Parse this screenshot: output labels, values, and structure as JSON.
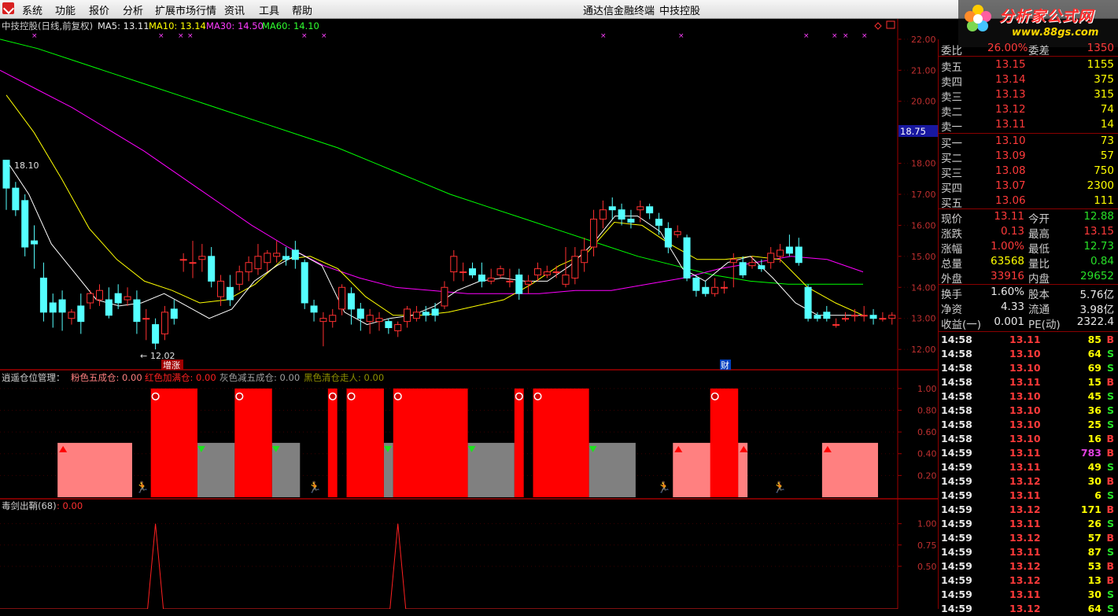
{
  "menubar": {
    "items": [
      "系统",
      "功能",
      "报价",
      "分析",
      "扩展市场行情",
      "资讯",
      "工具",
      "帮助"
    ],
    "center_title": "通达信金融终端",
    "center_stock": "中技控股"
  },
  "watermark": {
    "title": "分析家公式网",
    "url": "www.88gs.com"
  },
  "chart_header": {
    "name": "中技控股(日线,前复权)",
    "ma5": "MA5: 13.11",
    "ma10": "MA10: 13.14",
    "ma30": "MA30: 14.50",
    "ma60": "MA60: 14.10"
  },
  "panel2_header": {
    "title": "逍遥仓位管理：",
    "pink": "粉色五成仓: 0.00",
    "red": "红色加满仓: 0.00",
    "gray": "灰色减五成仓: 0.00",
    "black": "黑色清仓走人: 0.00"
  },
  "panel3_header": {
    "title": "毒剑出鞘(68)",
    "value": ": 0.00"
  },
  "annotations": {
    "high": "18.10",
    "low": "12.02",
    "tag1": "增涨",
    "tag2": "财",
    "price_marker": "18.75"
  },
  "axes": {
    "price": [
      "22.00",
      "21.00",
      "20.00",
      "18.00",
      "17.00",
      "16.00",
      "15.00",
      "14.00",
      "13.00",
      "12.00"
    ],
    "pos": [
      "1.00",
      "0.80",
      "0.60",
      "0.40",
      "0.20"
    ],
    "sig": [
      "1.00",
      "0.75",
      "0.50"
    ]
  },
  "colors": {
    "up": "#ff3030",
    "down": "#54ffff",
    "ma5": "#ffffff",
    "ma10": "#ffff00",
    "ma30": "#ff00ff",
    "ma60": "#00ff00"
  },
  "chart_data": [
    {
      "type": "candlestick",
      "title": "中技控股(日线,前复权)",
      "ylim": [
        11.8,
        22.2
      ],
      "candles": [
        [
          18.1,
          17.2,
          18.1,
          16.5
        ],
        [
          17.2,
          16.5,
          17.4,
          16.3
        ],
        [
          16.8,
          15.3,
          17.0,
          15.0
        ],
        [
          15.5,
          15.4,
          16.0,
          14.6
        ],
        [
          14.3,
          13.2,
          14.8,
          12.9
        ],
        [
          13.5,
          13.2,
          13.8,
          12.7
        ],
        [
          13.6,
          13.2,
          13.9,
          12.6
        ],
        [
          13.0,
          13.2,
          13.3,
          12.8
        ],
        [
          13.4,
          12.9,
          13.8,
          12.5
        ],
        [
          13.5,
          13.8,
          13.9,
          13.3
        ],
        [
          13.6,
          13.9,
          14.1,
          13.4
        ],
        [
          13.6,
          13.1,
          14.0,
          13.0
        ],
        [
          13.8,
          13.5,
          14.1,
          13.3
        ],
        [
          13.6,
          13.7,
          14.0,
          13.4
        ],
        [
          13.6,
          12.9,
          13.9,
          12.5
        ],
        [
          13.0,
          13.0,
          13.3,
          12.3
        ],
        [
          12.8,
          12.2,
          13.0,
          12.0
        ],
        [
          12.5,
          13.2,
          13.4,
          12.3
        ],
        [
          13.3,
          13.0,
          13.6,
          12.8
        ],
        [
          14.9,
          14.9,
          15.1,
          14.5
        ],
        [
          14.8,
          14.8,
          15.5,
          14.3
        ],
        [
          14.9,
          15.0,
          15.4,
          14.5
        ],
        [
          15.0,
          14.2,
          15.3,
          14.0
        ],
        [
          13.7,
          14.2,
          14.4,
          13.4
        ],
        [
          14.0,
          13.6,
          14.4,
          13.4
        ],
        [
          14.1,
          14.5,
          14.7,
          13.9
        ],
        [
          14.5,
          14.8,
          15.0,
          14.2
        ],
        [
          14.6,
          15.0,
          15.4,
          14.4
        ],
        [
          14.8,
          15.1,
          15.2,
          14.5
        ],
        [
          15.0,
          15.1,
          15.5,
          14.8
        ],
        [
          15.0,
          14.9,
          15.3,
          14.7
        ],
        [
          15.2,
          14.9,
          15.5,
          14.6
        ],
        [
          14.8,
          13.5,
          14.9,
          13.3
        ],
        [
          13.4,
          13.2,
          13.6,
          12.9
        ],
        [
          12.9,
          13.0,
          13.2,
          12.1
        ],
        [
          12.9,
          13.1,
          13.3,
          12.7
        ],
        [
          13.3,
          14.0,
          14.1,
          13.1
        ],
        [
          13.8,
          13.3,
          14.0,
          12.8
        ],
        [
          13.3,
          13.0,
          13.5,
          12.6
        ],
        [
          12.9,
          13.1,
          13.3,
          12.5
        ],
        [
          12.9,
          13.0,
          13.2,
          12.6
        ],
        [
          12.9,
          12.7,
          13.0,
          12.5
        ],
        [
          12.6,
          12.8,
          12.9,
          12.4
        ],
        [
          12.9,
          13.3,
          13.4,
          12.7
        ],
        [
          13.0,
          13.2,
          13.4,
          12.9
        ],
        [
          13.2,
          13.1,
          13.4,
          12.9
        ],
        [
          13.3,
          13.1,
          13.5,
          12.9
        ],
        [
          13.4,
          14.0,
          14.2,
          13.3
        ],
        [
          14.5,
          15.0,
          15.2,
          14.2
        ],
        [
          14.5,
          14.5,
          14.8,
          14.2
        ],
        [
          14.6,
          14.4,
          14.8,
          14.3
        ],
        [
          14.4,
          14.2,
          14.8,
          14.0
        ],
        [
          14.2,
          14.3,
          14.6,
          14.1
        ],
        [
          14.4,
          14.6,
          14.7,
          14.3
        ],
        [
          14.2,
          14.2,
          14.6,
          14.0
        ],
        [
          14.4,
          13.8,
          14.6,
          13.6
        ],
        [
          14.1,
          14.2,
          14.4,
          13.8
        ],
        [
          14.4,
          14.6,
          14.8,
          14.2
        ],
        [
          14.4,
          14.5,
          14.7,
          14.3
        ],
        [
          14.5,
          14.5,
          14.7,
          14.3
        ],
        [
          14.1,
          14.4,
          15.3,
          14.0
        ],
        [
          14.3,
          15.0,
          15.3,
          14.1
        ],
        [
          14.8,
          15.2,
          15.6,
          14.5
        ],
        [
          15.3,
          16.2,
          16.5,
          15.0
        ],
        [
          16.2,
          16.5,
          16.8,
          15.9
        ],
        [
          16.6,
          16.5,
          16.9,
          16.2
        ],
        [
          16.5,
          16.2,
          16.7,
          16.0
        ],
        [
          16.2,
          16.1,
          16.5,
          15.9
        ],
        [
          16.5,
          16.6,
          16.8,
          16.1
        ],
        [
          16.6,
          16.4,
          16.7,
          16.2
        ],
        [
          16.2,
          16.0,
          16.4,
          15.7
        ],
        [
          15.9,
          15.3,
          16.1,
          15.1
        ],
        [
          15.7,
          15.8,
          16.0,
          15.6
        ],
        [
          15.6,
          14.3,
          15.7,
          14.2
        ],
        [
          14.3,
          13.9,
          14.4,
          13.7
        ],
        [
          14.0,
          13.8,
          14.2,
          13.7
        ],
        [
          13.8,
          14.0,
          14.3,
          13.7
        ],
        [
          14.0,
          14.0,
          14.2,
          13.8
        ],
        [
          14.8,
          14.9,
          15.1,
          14.0
        ],
        [
          14.8,
          14.4,
          15.0,
          14.3
        ],
        [
          14.7,
          14.8,
          15.0,
          14.6
        ],
        [
          14.7,
          14.6,
          14.9,
          14.5
        ],
        [
          14.8,
          15.1,
          15.3,
          14.6
        ],
        [
          15.0,
          15.2,
          15.4,
          14.8
        ],
        [
          15.3,
          15.1,
          15.7,
          15.0
        ],
        [
          15.3,
          14.8,
          15.6,
          14.7
        ],
        [
          14.0,
          13.0,
          14.1,
          12.9
        ],
        [
          13.1,
          13.0,
          13.2,
          12.9
        ],
        [
          13.2,
          13.0,
          13.4,
          12.9
        ],
        [
          12.8,
          12.8,
          13.0,
          12.7
        ],
        [
          13.0,
          13.0,
          13.2,
          12.9
        ],
        [
          13.1,
          13.1,
          13.3,
          12.9
        ],
        [
          13.1,
          13.1,
          13.4,
          12.9
        ],
        [
          13.1,
          13.0,
          13.3,
          12.8
        ],
        [
          13.0,
          13.0,
          13.2,
          12.9
        ],
        [
          13.0,
          13.1,
          13.2,
          12.8
        ]
      ],
      "ma60": [
        22.0,
        21.7,
        21.3,
        20.9,
        20.5,
        20.1,
        19.7,
        19.3,
        18.9,
        18.5,
        18.0,
        17.5,
        17.0,
        16.6,
        16.2,
        15.8,
        15.4,
        15.0,
        14.7,
        14.4,
        14.2,
        14.1,
        14.1,
        14.1
      ],
      "ma30": [
        21.0,
        20.4,
        19.8,
        19.1,
        18.4,
        17.6,
        16.8,
        16.0,
        15.3,
        14.7,
        14.3,
        14.0,
        13.9,
        13.8,
        13.8,
        13.8,
        13.9,
        13.9,
        14.1,
        14.3,
        14.6,
        14.8,
        15.0,
        14.9,
        14.5
      ],
      "ma10": [
        20.2,
        19.0,
        17.5,
        15.9,
        14.9,
        14.2,
        13.9,
        13.5,
        13.6,
        14.1,
        14.9,
        15.0,
        14.6,
        13.7,
        13.1,
        13.1,
        13.2,
        13.4,
        13.6,
        14.1,
        14.7,
        15.1,
        16.1,
        16.0,
        15.4,
        14.9,
        14.9,
        15.0,
        14.9,
        14.0,
        13.5,
        13.1
      ],
      "ma5": [
        18.1,
        17.0,
        15.4,
        14.5,
        13.6,
        13.4,
        13.5,
        13.8,
        13.4,
        13.0,
        13.3,
        14.2,
        14.7,
        15.1,
        14.7,
        13.2,
        12.8,
        13.0,
        13.1,
        13.4,
        13.9,
        14.2,
        14.3,
        14.2,
        14.2,
        14.7,
        15.4,
        16.3,
        16.3,
        15.8,
        14.6,
        14.2,
        14.8,
        15.0,
        14.3,
        13.5,
        13.1,
        13.1,
        13.1
      ]
    },
    {
      "type": "area",
      "title": "逍遥仓位管理",
      "ylim": [
        0,
        1.1
      ],
      "pink": [
        [
          6,
          13
        ],
        [
          72,
          76
        ],
        [
          79,
          79
        ],
        [
          88,
          93
        ]
      ],
      "red": [
        [
          16,
          20
        ],
        [
          25,
          28
        ],
        [
          35,
          35
        ],
        [
          37,
          40
        ],
        [
          42,
          49
        ],
        [
          55,
          55
        ],
        [
          57,
          62
        ],
        [
          76,
          78
        ]
      ],
      "gray": [
        [
          21,
          24
        ],
        [
          29,
          31
        ],
        [
          41,
          41
        ],
        [
          50,
          54
        ],
        [
          63,
          67
        ],
        [
          79,
          79
        ]
      ],
      "pink_value": 0.5,
      "red_value": 1.0,
      "gray_value": 0.5
    },
    {
      "type": "line",
      "title": "毒剑出鞘(68)",
      "ylim": [
        0,
        1.2
      ],
      "peaks": [
        16,
        42
      ]
    }
  ],
  "quote": {
    "wei": {
      "l1": "委比",
      "v1": "26.00%",
      "l2": "委差",
      "v2": "1350"
    },
    "sells": [
      {
        "label": "卖五",
        "price": "13.15",
        "vol": "1155"
      },
      {
        "label": "卖四",
        "price": "13.14",
        "vol": "375"
      },
      {
        "label": "卖三",
        "price": "13.13",
        "vol": "315"
      },
      {
        "label": "卖二",
        "price": "13.12",
        "vol": "74"
      },
      {
        "label": "卖一",
        "price": "13.11",
        "vol": "14"
      }
    ],
    "buys": [
      {
        "label": "买一",
        "price": "13.10",
        "vol": "73"
      },
      {
        "label": "买二",
        "price": "13.09",
        "vol": "57"
      },
      {
        "label": "买三",
        "price": "13.08",
        "vol": "750"
      },
      {
        "label": "买四",
        "price": "13.07",
        "vol": "2300"
      },
      {
        "label": "买五",
        "price": "13.06",
        "vol": "111"
      }
    ],
    "stats": [
      {
        "l1": "现价",
        "v1": "13.11",
        "c1": "red",
        "l2": "今开",
        "v2": "12.88",
        "c2": "grn"
      },
      {
        "l1": "涨跌",
        "v1": "0.13",
        "c1": "red",
        "l2": "最高",
        "v2": "13.15",
        "c2": "red"
      },
      {
        "l1": "涨幅",
        "v1": "1.00%",
        "c1": "red",
        "l2": "最低",
        "v2": "12.73",
        "c2": "grn"
      },
      {
        "l1": "总量",
        "v1": "63568",
        "c1": "yel",
        "l2": "量比",
        "v2": "0.84",
        "c2": "grn"
      },
      {
        "l1": "外盘",
        "v1": "33916",
        "c1": "red",
        "l2": "内盘",
        "v2": "29652",
        "c2": "grn"
      }
    ],
    "stats2": [
      {
        "l1": "换手",
        "v1": "1.60%",
        "l2": "股本",
        "v2": "5.76亿"
      },
      {
        "l1": "净资",
        "v1": "4.33",
        "l2": "流通",
        "v2": "3.98亿"
      },
      {
        "l1": "收益(一)",
        "v1": "0.001",
        "l2": "PE(动)",
        "v2": "2322.4"
      }
    ],
    "trades": [
      {
        "t": "14:58",
        "p": "13.11",
        "pc": "red",
        "v": "85",
        "vc": "yel",
        "s": "B"
      },
      {
        "t": "14:58",
        "p": "13.10",
        "pc": "red",
        "v": "64",
        "vc": "yel",
        "s": "S"
      },
      {
        "t": "14:58",
        "p": "13.10",
        "pc": "red",
        "v": "69",
        "vc": "yel",
        "s": "S"
      },
      {
        "t": "14:58",
        "p": "13.11",
        "pc": "red",
        "v": "15",
        "vc": "yel",
        "s": "B"
      },
      {
        "t": "14:58",
        "p": "13.10",
        "pc": "red",
        "v": "45",
        "vc": "yel",
        "s": "S"
      },
      {
        "t": "14:58",
        "p": "13.10",
        "pc": "red",
        "v": "36",
        "vc": "yel",
        "s": "S"
      },
      {
        "t": "14:58",
        "p": "13.10",
        "pc": "red",
        "v": "25",
        "vc": "yel",
        "s": "S"
      },
      {
        "t": "14:58",
        "p": "13.10",
        "pc": "red",
        "v": "16",
        "vc": "yel",
        "s": "B"
      },
      {
        "t": "14:59",
        "p": "13.11",
        "pc": "red",
        "v": "783",
        "vc": "mag",
        "s": "B"
      },
      {
        "t": "14:59",
        "p": "13.11",
        "pc": "red",
        "v": "49",
        "vc": "yel",
        "s": "S"
      },
      {
        "t": "14:59",
        "p": "13.12",
        "pc": "red",
        "v": "30",
        "vc": "yel",
        "s": "B"
      },
      {
        "t": "14:59",
        "p": "13.11",
        "pc": "red",
        "v": "6",
        "vc": "yel",
        "s": "S"
      },
      {
        "t": "14:59",
        "p": "13.12",
        "pc": "red",
        "v": "171",
        "vc": "yel",
        "s": "B"
      },
      {
        "t": "14:59",
        "p": "13.11",
        "pc": "red",
        "v": "26",
        "vc": "yel",
        "s": "S"
      },
      {
        "t": "14:59",
        "p": "13.12",
        "pc": "red",
        "v": "57",
        "vc": "yel",
        "s": "B"
      },
      {
        "t": "14:59",
        "p": "13.11",
        "pc": "red",
        "v": "87",
        "vc": "yel",
        "s": "S"
      },
      {
        "t": "14:59",
        "p": "13.12",
        "pc": "red",
        "v": "53",
        "vc": "yel",
        "s": "B"
      },
      {
        "t": "14:59",
        "p": "13.12",
        "pc": "red",
        "v": "13",
        "vc": "yel",
        "s": "B"
      },
      {
        "t": "14:59",
        "p": "13.11",
        "pc": "red",
        "v": "30",
        "vc": "yel",
        "s": "S"
      },
      {
        "t": "14:59",
        "p": "13.12",
        "pc": "red",
        "v": "64",
        "vc": "yel",
        "s": "S"
      }
    ]
  }
}
